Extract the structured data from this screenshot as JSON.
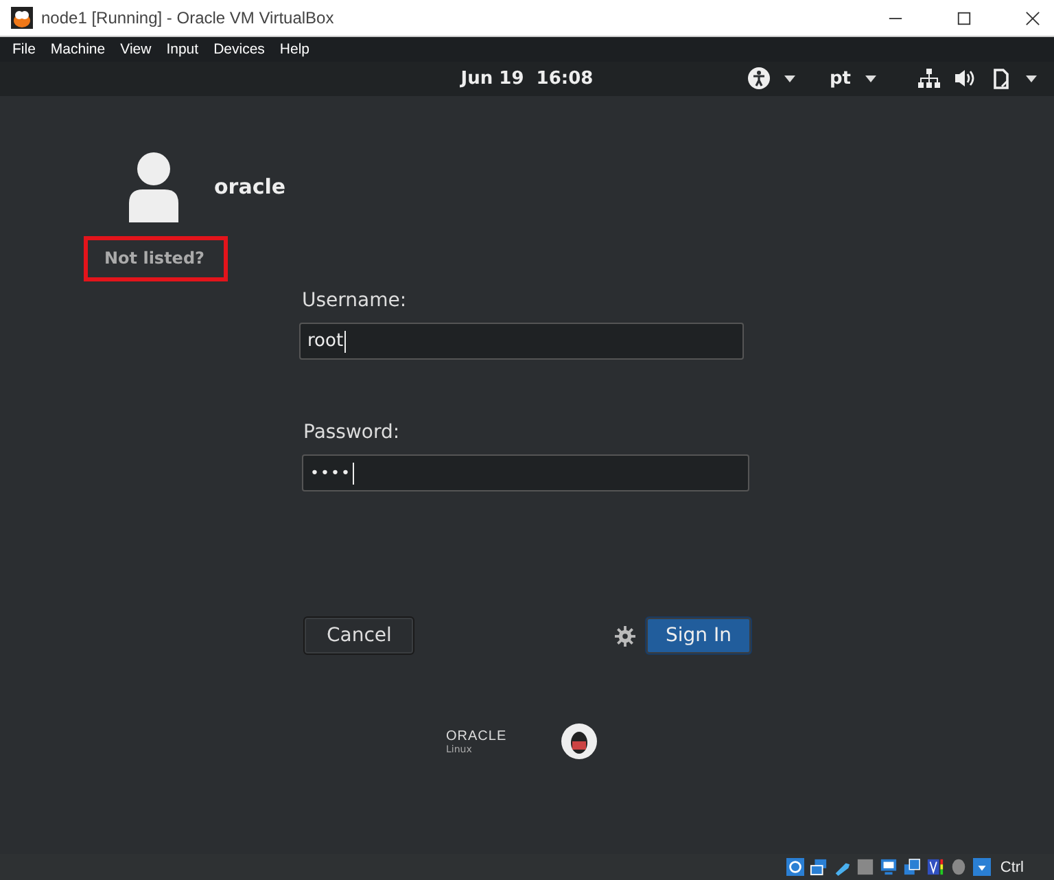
{
  "window": {
    "title": "node1 [Running] - Oracle VM VirtualBox"
  },
  "menu": [
    "File",
    "Machine",
    "View",
    "Input",
    "Devices",
    "Help"
  ],
  "top_bar": {
    "clock": "Jun 19  16:08",
    "keyboard_layout": "pt"
  },
  "user": {
    "name": "oracle"
  },
  "not_listed": "Not listed?",
  "username": {
    "label": "Username:",
    "value": "root"
  },
  "password": {
    "label": "Password:",
    "value": "••••"
  },
  "buttons": {
    "cancel": "Cancel",
    "sign_in": "Sign In"
  },
  "logo": {
    "brand": "ORACLE",
    "product": "Linux"
  },
  "status_bar": {
    "host_key": "Ctrl"
  }
}
